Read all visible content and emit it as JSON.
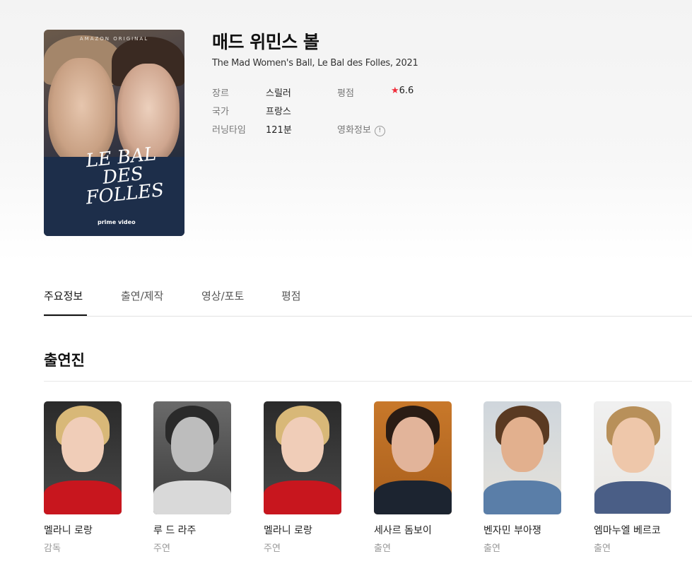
{
  "movie": {
    "title": "매드 위민스 볼",
    "subtitle": "The Mad Women's Ball, Le Bal des Folles, 2021",
    "poster": {
      "top_text": "AMAZON ORIGINAL",
      "title_text": "LE BAL DES FOLLES",
      "brand_text": "prime video"
    },
    "info": {
      "genre_label": "장르",
      "genre": "스릴러",
      "country_label": "국가",
      "country": "프랑스",
      "runtime_label": "러닝타임",
      "runtime": "121분",
      "rating_label": "평점",
      "rating": "6.6",
      "movieinfo_label": "영화정보"
    }
  },
  "tabs": [
    {
      "label": "주요정보",
      "active": true
    },
    {
      "label": "출연/제작",
      "active": false
    },
    {
      "label": "영상/포토",
      "active": false
    },
    {
      "label": "평점",
      "active": false
    }
  ],
  "cast_section": {
    "title": "출연진",
    "members": [
      {
        "name": "멜라니 로랑",
        "role": "감독"
      },
      {
        "name": "루 드 라주",
        "role": "주연"
      },
      {
        "name": "멜라니 로랑",
        "role": "주연"
      },
      {
        "name": "세사르 돔보이",
        "role": "출연"
      },
      {
        "name": "벤자민 부아쟁",
        "role": "출연"
      },
      {
        "name": "엠마누엘 베르코",
        "role": "출연"
      }
    ]
  },
  "colors": {
    "accent_star": "#f02d3b",
    "text_dark": "#111111",
    "text_muted": "#999999"
  },
  "icons": {
    "expand": "expand-icon",
    "star": "star-icon",
    "info": "info-icon"
  }
}
